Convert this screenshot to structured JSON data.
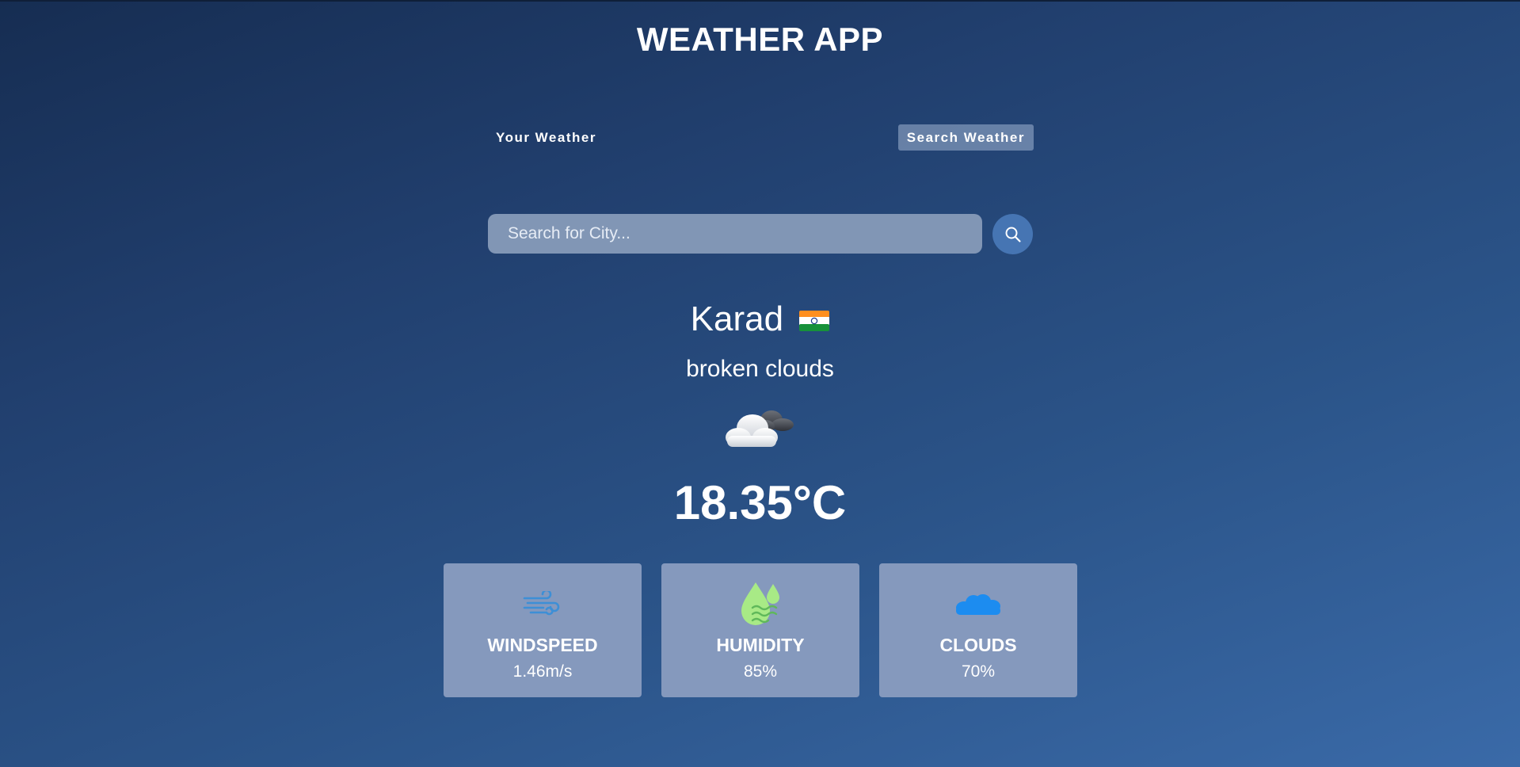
{
  "app": {
    "title": "WEATHER APP"
  },
  "tabs": [
    {
      "label": "Your Weather",
      "active": false
    },
    {
      "label": "Search Weather",
      "active": true
    }
  ],
  "search": {
    "placeholder": "Search for City...",
    "value": "",
    "icon": "search-icon"
  },
  "weather": {
    "city": "Karad",
    "country_flag": "india-flag",
    "description": "broken clouds",
    "condition_icon": "cloud-icon",
    "temperature": "18.35°C"
  },
  "stats": [
    {
      "label": "WINDSPEED",
      "value": "1.46m/s",
      "icon": "wind-icon",
      "color": "#3d8fd6"
    },
    {
      "label": "HUMIDITY",
      "value": "85%",
      "icon": "humidity-icon",
      "color": "#a8ea86"
    },
    {
      "label": "CLOUDS",
      "value": "70%",
      "icon": "clouds-icon",
      "color": "#1c8cf0"
    }
  ],
  "colors": {
    "background_top": "#162d52",
    "background_bottom": "#3a6aa8",
    "input_bg": "#8196b5",
    "search_button": "#4675b3",
    "card_bg": "#8599bd"
  }
}
